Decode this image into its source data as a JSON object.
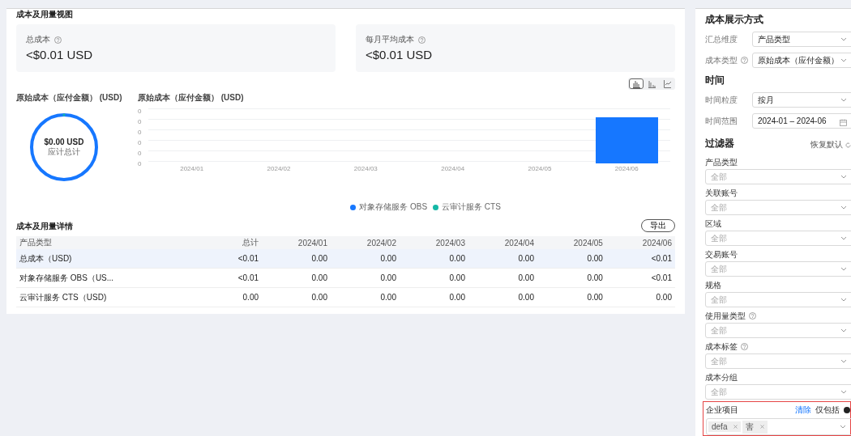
{
  "overview": {
    "title": "成本及用量视图",
    "stats": [
      {
        "label": "总成本",
        "help": true,
        "value": "<$0.01 USD"
      },
      {
        "label": "每月平均成本",
        "help": true,
        "value": "<$0.01 USD"
      }
    ],
    "chart_types": [
      {
        "kind": "grouped",
        "selected": true
      },
      {
        "kind": "bar",
        "selected": false
      },
      {
        "kind": "line",
        "selected": false
      }
    ],
    "donut": {
      "title": "原始成本（应付金额）  (USD)",
      "value": "$0.00 USD",
      "caption": "应计总计"
    },
    "chart": {
      "title": "原始成本（应付金额）  (USD)",
      "y_labels": [
        "0",
        "0",
        "0",
        "0",
        "0",
        "0"
      ],
      "bars": [
        {
          "label": "2024/01",
          "filled": false
        },
        {
          "label": "2024/02",
          "filled": false
        },
        {
          "label": "2024/03",
          "filled": false
        },
        {
          "label": "2024/04",
          "filled": false
        },
        {
          "label": "2024/05",
          "filled": false
        },
        {
          "label": "2024/06",
          "filled": true
        }
      ]
    },
    "legend": [
      {
        "label": "对象存储服务 OBS",
        "color": "#1677ff"
      },
      {
        "label": "云审计服务 CTS",
        "color": "#14b8a6"
      }
    ]
  },
  "details": {
    "title": "成本及用量详情",
    "export": "导出",
    "columns": [
      "产品类型",
      "总计",
      "2024/01",
      "2024/02",
      "2024/03",
      "2024/04",
      "2024/05",
      "2024/06"
    ],
    "rows": [
      {
        "highlighted": true,
        "cells": [
          "总成本（USD)",
          "<0.01",
          "0.00",
          "0.00",
          "0.00",
          "0.00",
          "0.00",
          "<0.01"
        ]
      },
      {
        "highlighted": false,
        "cells": [
          "对象存储服务 OBS（US...",
          "<0.01",
          "0.00",
          "0.00",
          "0.00",
          "0.00",
          "0.00",
          "<0.01"
        ]
      },
      {
        "highlighted": false,
        "cells": [
          "云审计服务 CTS（USD)",
          "0.00",
          "0.00",
          "0.00",
          "0.00",
          "0.00",
          "0.00",
          "0.00"
        ]
      }
    ]
  },
  "sidebar": {
    "display": {
      "title": "成本展示方式",
      "fields": [
        {
          "label": "汇总维度",
          "help": false,
          "value": "产品类型"
        },
        {
          "label": "成本类型",
          "help": true,
          "value": "原始成本（应付金额）"
        }
      ]
    },
    "time": {
      "title": "时间",
      "fields": [
        {
          "label": "时间粒度",
          "help": false,
          "kind": "select",
          "value": "按月"
        },
        {
          "label": "时间范围",
          "help": false,
          "kind": "date",
          "value": "2024-01 – 2024-06"
        }
      ]
    },
    "filters": {
      "title": "过滤器",
      "reset": "恢复默认",
      "items": [
        {
          "label": "产品类型",
          "help": false,
          "placeholder": "全部"
        },
        {
          "label": "关联账号",
          "help": false,
          "placeholder": "全部"
        },
        {
          "label": "区域",
          "help": false,
          "placeholder": "全部"
        },
        {
          "label": "交易账号",
          "help": false,
          "placeholder": "全部"
        },
        {
          "label": "规格",
          "help": false,
          "placeholder": "全部"
        },
        {
          "label": "使用量类型",
          "help": true,
          "placeholder": "全部"
        },
        {
          "label": "成本标签",
          "help": true,
          "placeholder": "全部"
        },
        {
          "label": "成本分组",
          "help": false,
          "placeholder": "全部"
        }
      ],
      "project": {
        "label": "企业项目",
        "highlighted": true,
        "clear": "清除",
        "mode": "仅包括",
        "tags": [
          "defa",
          "害"
        ]
      }
    }
  }
}
